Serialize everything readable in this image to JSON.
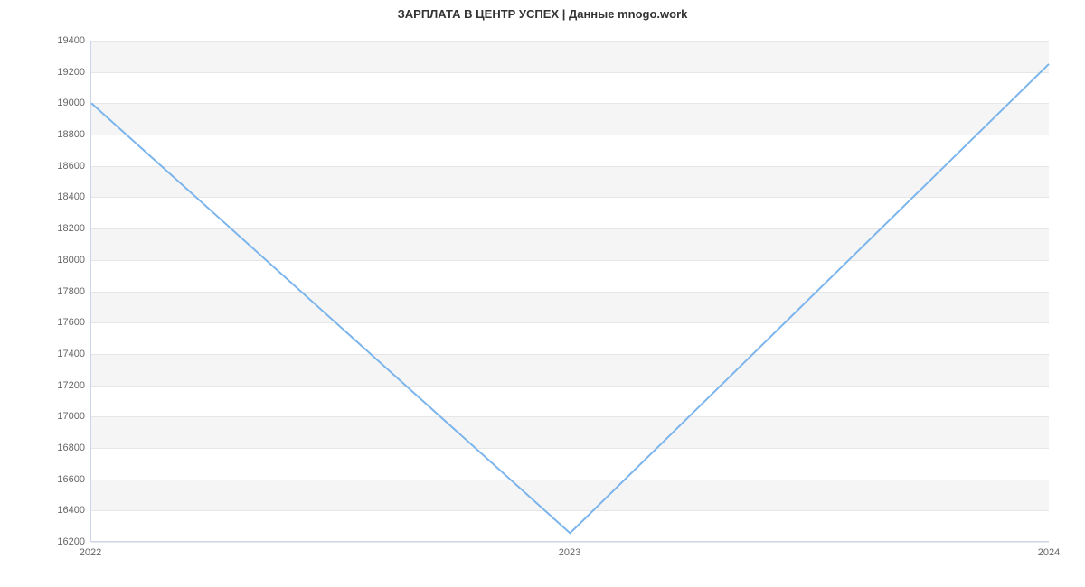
{
  "chart_data": {
    "type": "line",
    "title": "ЗАРПЛАТА В ЦЕНТР УСПЕХ | Данные mnogo.work",
    "xlabel": "",
    "ylabel": "",
    "x": [
      "2022",
      "2023",
      "2024"
    ],
    "values": [
      19000,
      16250,
      19250
    ],
    "ylim": [
      16200,
      19400
    ],
    "yticks": [
      16200,
      16400,
      16600,
      16800,
      17000,
      17200,
      17400,
      17600,
      17800,
      18000,
      18200,
      18400,
      18600,
      18800,
      19000,
      19200,
      19400
    ],
    "line_color": "#7cb5ec"
  }
}
